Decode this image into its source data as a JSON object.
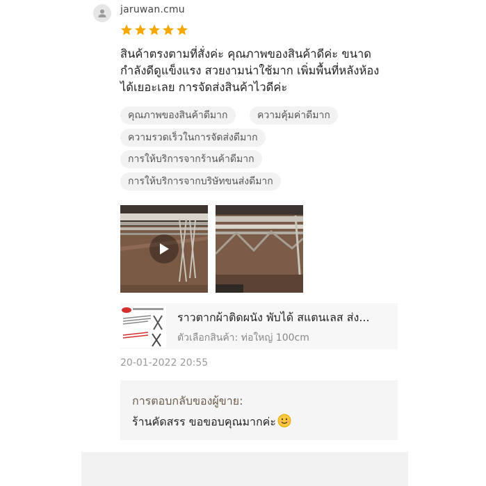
{
  "reviewer": {
    "username": "jaruwan.cmu",
    "avatar_icon": "user-icon"
  },
  "rating": {
    "stars": 5,
    "max": 5,
    "color": "#f6a700"
  },
  "review": {
    "lines": [
      "สินค้าตรงตามที่สั่งค่ะ คุณภาพของสินค้าดีค่ะ ขนาด",
      "กำลังดีดูแข็งแรง สวยงามน่าใช้มาก เพิ่มพื้นที่หลังห้อง",
      "ได้เยอะเลย การจัดส่งสินค้าไวดีค่ะ"
    ]
  },
  "tags": [
    "คุณภาพของสินค้าดีมาก",
    "ความคุ้มค่าดีมาก",
    "ความรวดเร็วในการจัดส่งดีมาก",
    "การให้บริการจากร้านค้าดีมาก",
    "การให้บริการจากบริษัทขนส่งดีมาก"
  ],
  "media": [
    {
      "type": "video",
      "icon": "play-icon"
    },
    {
      "type": "image"
    }
  ],
  "product": {
    "title": "ราวตากผ้าติดผนัง พับได้ สแตนเลส ส่ง...",
    "variant": "ตัวเลือกสินค้า: ท่อใหญ่ 100cm"
  },
  "timestamp": "20-01-2022 20:55",
  "seller_reply": {
    "label": "การตอบกลับของผู้ขาย:",
    "text": "ร้านคัดสรร ขอขอบคุณมากค่ะ",
    "emoji_icon": "smile-emoji-icon",
    "label_color": "#6b5a4a"
  }
}
